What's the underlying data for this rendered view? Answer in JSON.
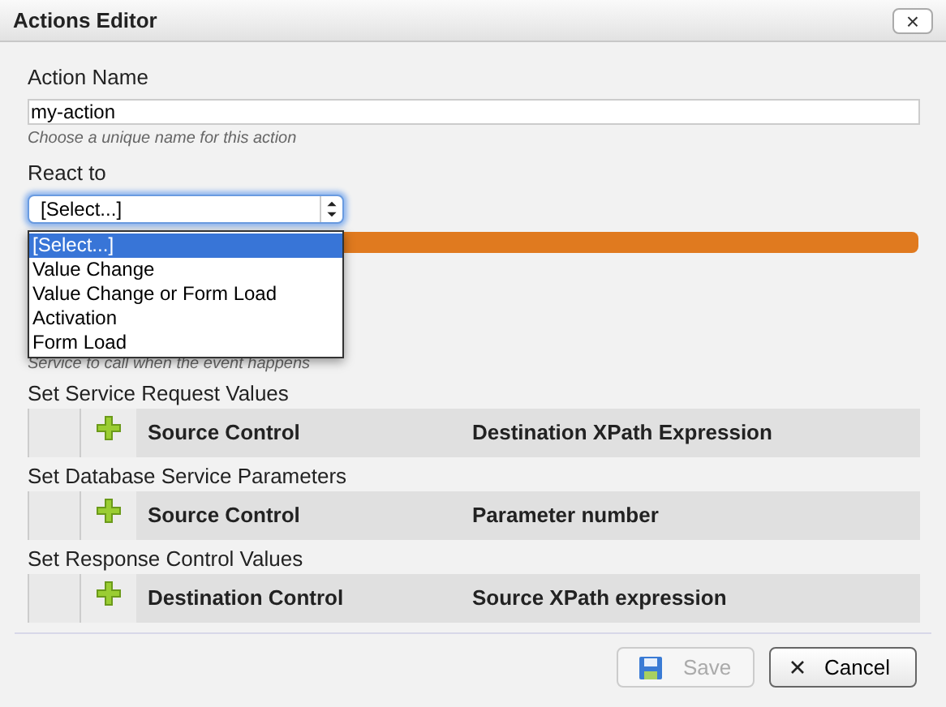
{
  "window": {
    "title": "Actions Editor",
    "close": "×"
  },
  "action_name": {
    "label": "Action Name",
    "value": "my-action",
    "hint": "Choose a unique name for this action"
  },
  "react_to": {
    "label": "React to",
    "value": "[Select...]",
    "expanded": true,
    "options": [
      {
        "label": "[Select...]",
        "selected": true
      },
      {
        "label": "Value Change",
        "selected": false
      },
      {
        "label": "Value Change or Form Load",
        "selected": false
      },
      {
        "label": "Activation",
        "selected": false
      },
      {
        "label": "Form Load",
        "selected": false
      }
    ]
  },
  "service_hint": "Service to call when the event happens",
  "sections": [
    {
      "title": "Set Service Request Values",
      "columns": [
        "Source Control",
        "Destination XPath Expression"
      ]
    },
    {
      "title": "Set Database Service Parameters",
      "columns": [
        "Source Control",
        "Parameter number"
      ]
    },
    {
      "title": "Set Response Control Values",
      "columns": [
        "Destination Control",
        "Source XPath expression"
      ]
    }
  ],
  "buttons": [
    {
      "kind": "save",
      "label": "Save",
      "disabled": true
    },
    {
      "kind": "cancel",
      "label": "Cancel",
      "disabled": false
    }
  ]
}
